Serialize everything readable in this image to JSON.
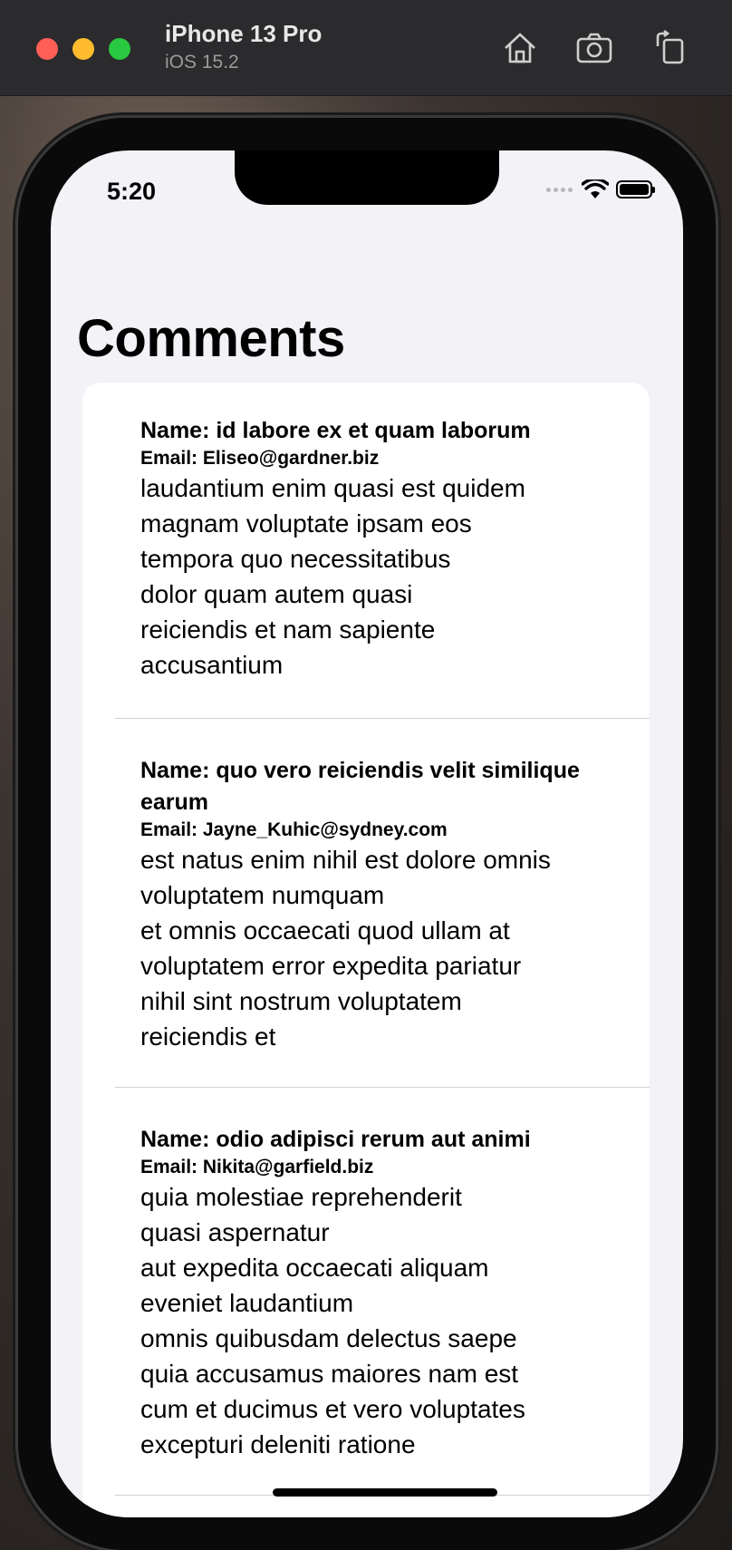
{
  "simulator": {
    "device": "iPhone 13 Pro",
    "os": "iOS 15.2"
  },
  "status_bar": {
    "time": "5:20"
  },
  "page": {
    "title": "Comments"
  },
  "comments": [
    {
      "name": "Name: id labore ex et quam laborum",
      "email": "Email: Eliseo@gardner.biz",
      "body": "laudantium enim quasi est quidem\nmagnam voluptate ipsam eos\ntempora quo necessitatibus\ndolor quam autem quasi\nreiciendis et nam sapiente\naccusantium"
    },
    {
      "name": "Name: quo vero reiciendis velit similique earum",
      "email": "Email: Jayne_Kuhic@sydney.com",
      "body": "est natus enim nihil est dolore omnis voluptatem numquam\net omnis occaecati quod ullam at\nvoluptatem error expedita pariatur\nnihil sint nostrum voluptatem\nreiciendis et"
    },
    {
      "name": "Name: odio adipisci rerum aut animi",
      "email": "Email: Nikita@garfield.biz",
      "body": "quia molestiae reprehenderit\nquasi aspernatur\naut expedita occaecati aliquam\neveniet laudantium\nomnis quibusdam delectus saepe\nquia accusamus maiores nam est\ncum et ducimus et vero voluptates\nexcepturi deleniti ratione"
    }
  ]
}
